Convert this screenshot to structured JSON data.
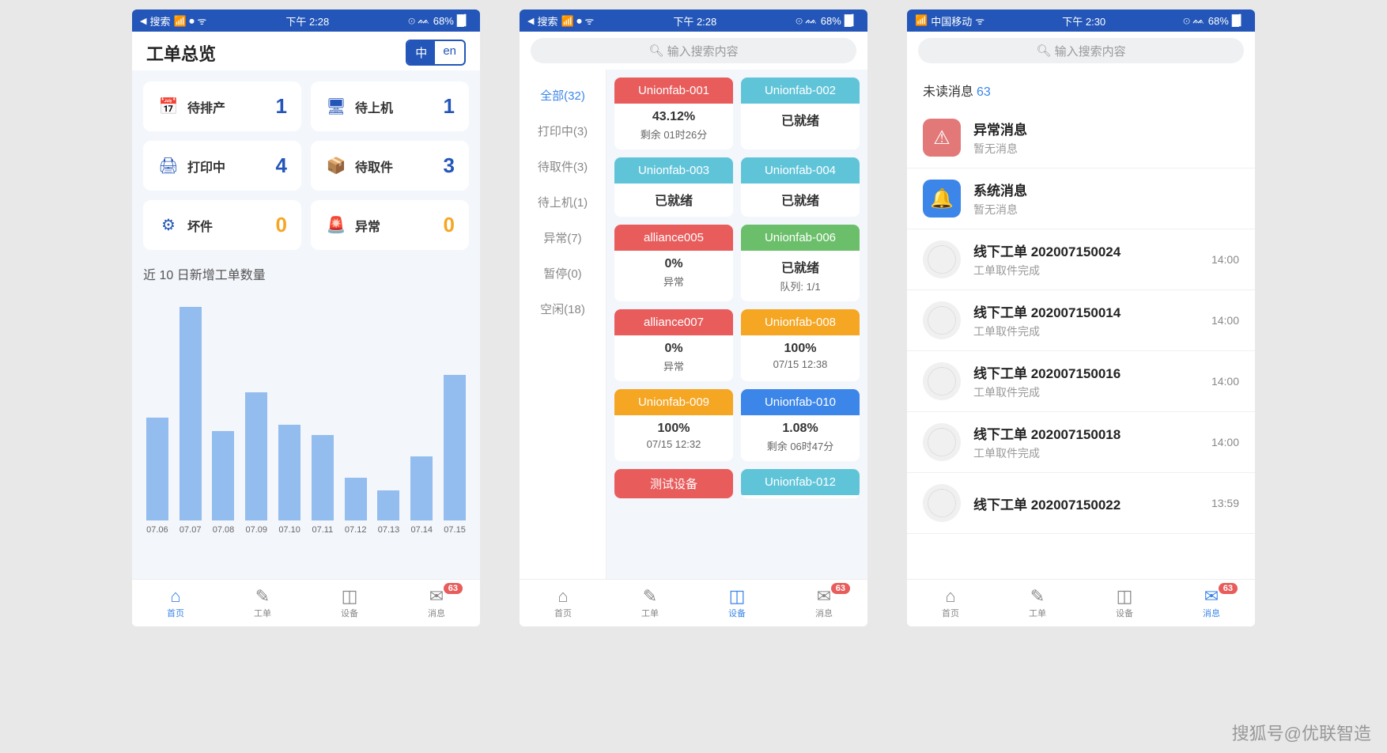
{
  "status": {
    "left1": "搜索",
    "carrier": "中国移动",
    "time": "下午 2:28",
    "time3": "下午 2:30",
    "battery": "68%"
  },
  "screen1": {
    "title": "工单总览",
    "lang": {
      "zh": "中",
      "en": "en"
    },
    "stats": [
      {
        "icon": "📅",
        "label": "待排产",
        "value": "1",
        "cls": "stat-blue"
      },
      {
        "icon": "🖥",
        "label": "待上机",
        "value": "1",
        "cls": "stat-blue"
      },
      {
        "icon": "🖨",
        "label": "打印中",
        "value": "4",
        "cls": "stat-blue"
      },
      {
        "icon": "📦",
        "label": "待取件",
        "value": "3",
        "cls": "stat-blue"
      },
      {
        "icon": "⚙",
        "label": "坏件",
        "value": "0",
        "cls": "stat-orange"
      },
      {
        "icon": "🚨",
        "label": "异常",
        "value": "0",
        "cls": "stat-orange"
      }
    ],
    "chart_title": "近 10 日新增工单数量"
  },
  "chart_data": {
    "type": "bar",
    "title": "近 10 日新增工单数量",
    "categories": [
      "07.06",
      "07.07",
      "07.08",
      "07.09",
      "07.10",
      "07.11",
      "07.12",
      "07.13",
      "07.14",
      "07.15"
    ],
    "values": [
      48,
      100,
      42,
      60,
      45,
      40,
      20,
      14,
      30,
      68
    ],
    "ylim": [
      0,
      100
    ]
  },
  "screen2": {
    "search_placeholder": "输入搜索内容",
    "filters": [
      {
        "label": "全部(32)",
        "active": true
      },
      {
        "label": "打印中(3)"
      },
      {
        "label": "待取件(3)"
      },
      {
        "label": "待上机(1)"
      },
      {
        "label": "异常(7)"
      },
      {
        "label": "暂停(0)"
      },
      {
        "label": "空闲(18)"
      }
    ],
    "devices": [
      {
        "name": "Unionfab-001",
        "color": "bg-red",
        "main": "43.12%",
        "sub": "剩余 01时26分"
      },
      {
        "name": "Unionfab-002",
        "color": "bg-lightblue",
        "main": "已就绪",
        "sub": ""
      },
      {
        "name": "Unionfab-003",
        "color": "bg-lightblue",
        "main": "已就绪",
        "sub": ""
      },
      {
        "name": "Unionfab-004",
        "color": "bg-lightblue",
        "main": "已就绪",
        "sub": ""
      },
      {
        "name": "alliance005",
        "color": "bg-red",
        "main": "0%",
        "sub": "异常"
      },
      {
        "name": "Unionfab-006",
        "color": "bg-green",
        "main": "已就绪",
        "sub": "队列: 1/1"
      },
      {
        "name": "alliance007",
        "color": "bg-red",
        "main": "0%",
        "sub": "异常"
      },
      {
        "name": "Unionfab-008",
        "color": "bg-orange",
        "main": "100%",
        "sub": "07/15 12:38"
      },
      {
        "name": "Unionfab-009",
        "color": "bg-orange",
        "main": "100%",
        "sub": "07/15 12:32"
      },
      {
        "name": "Unionfab-010",
        "color": "bg-blue",
        "main": "1.08%",
        "sub": "剩余 06时47分"
      },
      {
        "name": "测试设备",
        "color": "bg-red",
        "main": "",
        "sub": ""
      },
      {
        "name": "Unionfab-012",
        "color": "bg-lightblue",
        "main": "",
        "sub": ""
      }
    ]
  },
  "screen3": {
    "search_placeholder": "输入搜索内容",
    "unread_label": "未读消息",
    "unread_count": "63",
    "alert": {
      "title": "异常消息",
      "sub": "暂无消息"
    },
    "system": {
      "title": "系统消息",
      "sub": "暂无消息"
    },
    "messages": [
      {
        "title": "线下工单 202007150024",
        "sub": "工单取件完成",
        "time": "14:00"
      },
      {
        "title": "线下工单 202007150014",
        "sub": "工单取件完成",
        "time": "14:00"
      },
      {
        "title": "线下工单 202007150016",
        "sub": "工单取件完成",
        "time": "14:00"
      },
      {
        "title": "线下工单 202007150018",
        "sub": "工单取件完成",
        "time": "14:00"
      },
      {
        "title": "线下工单 202007150022",
        "sub": "",
        "time": "13:59"
      }
    ]
  },
  "tabs": [
    {
      "icon": "⌂",
      "label": "首页"
    },
    {
      "icon": "✎",
      "label": "工单"
    },
    {
      "icon": "◫",
      "label": "设备"
    },
    {
      "icon": "✉",
      "label": "消息",
      "badge": "63"
    }
  ],
  "watermark": "搜狐号@优联智造"
}
